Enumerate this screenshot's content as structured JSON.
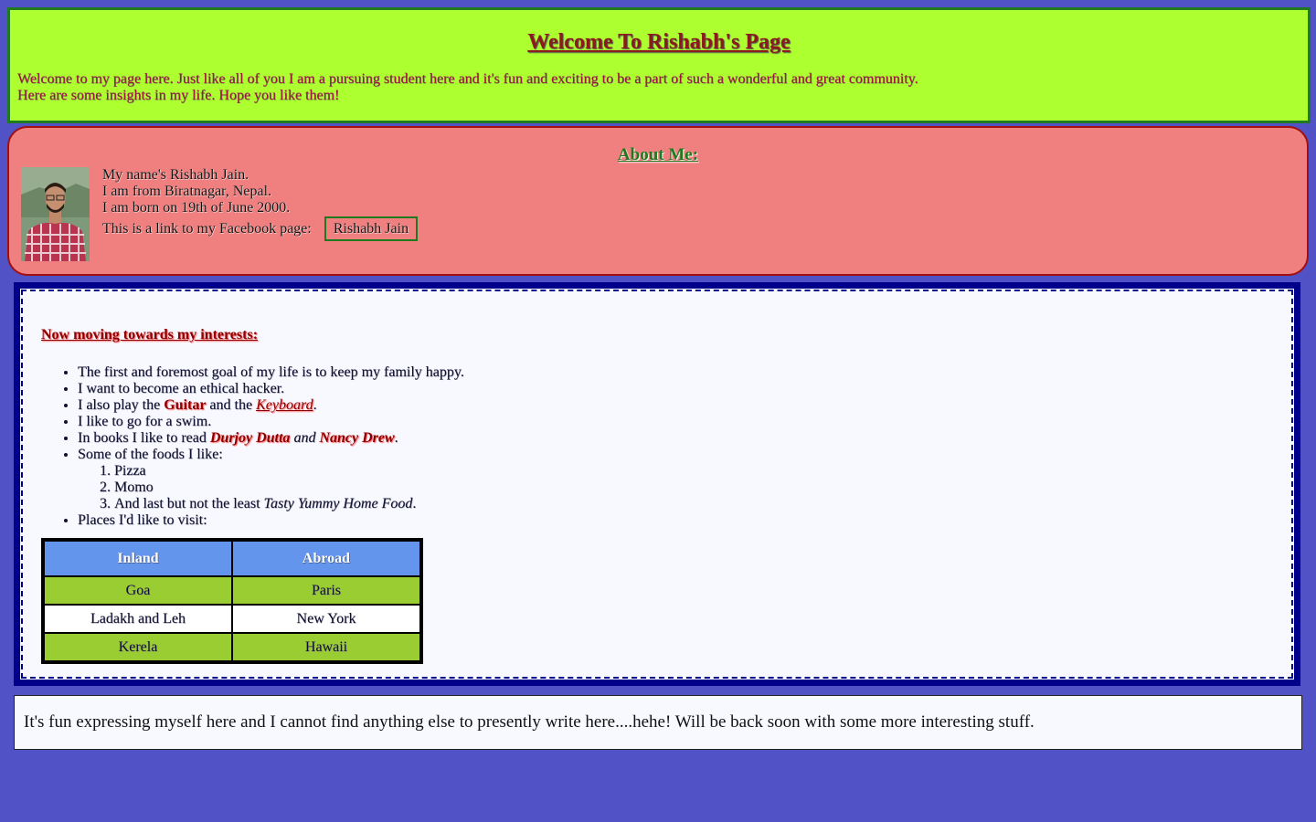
{
  "header": {
    "title": "Welcome To Rishabh's Page",
    "intro_line1": "Welcome to my page here. Just like all of you I am a pursuing student here and it's fun and exciting to be a part of such a wonderful and great community.",
    "intro_line2": "Here are some insights in my life. Hope you like them!"
  },
  "about": {
    "heading": "About Me:",
    "line1": "My name's Rishabh Jain.",
    "line2": "I am from Biratnagar, Nepal.",
    "line3": "I am born on 19th of June 2000.",
    "line4": "This is a link to my Facebook page:",
    "facebook_link": "Rishabh Jain"
  },
  "interests": {
    "heading": "Now moving towards my interests:",
    "item1": "The first and foremost goal of my life is to keep my family happy.",
    "item2": "I want to become an ethical hacker.",
    "item3_a": "I also play the ",
    "item3_guitar": "Guitar",
    "item3_b": " and the ",
    "item3_keyboard": "Keyboard",
    "item3_c": ".",
    "item4": "I like to go for a swim.",
    "item5_a": "In books I like to read ",
    "item5_author1": "Durjoy Dutta",
    "item5_and": " and ",
    "item5_author2": "Nancy Drew",
    "item5_c": ".",
    "item6": "Some of the foods I like:",
    "foods": {
      "f1": "Pizza",
      "f2": "Momo",
      "f3_a": "And last but not the least ",
      "f3_em": "Tasty Yummy Home Food",
      "f3_c": "."
    },
    "item7": "Places I'd like to visit:",
    "places_table": {
      "headers": [
        "Inland",
        "Abroad"
      ],
      "rows": [
        [
          "Goa",
          "Paris"
        ],
        [
          "Ladakh and Leh",
          "New York"
        ],
        [
          "Kerela",
          "Hawaii"
        ]
      ]
    }
  },
  "footer": {
    "text": "It's fun expressing myself here and I cannot find anything else to presently write here....hehe! Will be back soon with some more interesting stuff."
  },
  "colors": {
    "page_bg": "#5152c6",
    "header_bg": "#adff2f",
    "about_bg": "#f08080",
    "interests_border": "#00008b",
    "table_header_bg": "#6495ed",
    "table_green_row": "#9acd32"
  }
}
